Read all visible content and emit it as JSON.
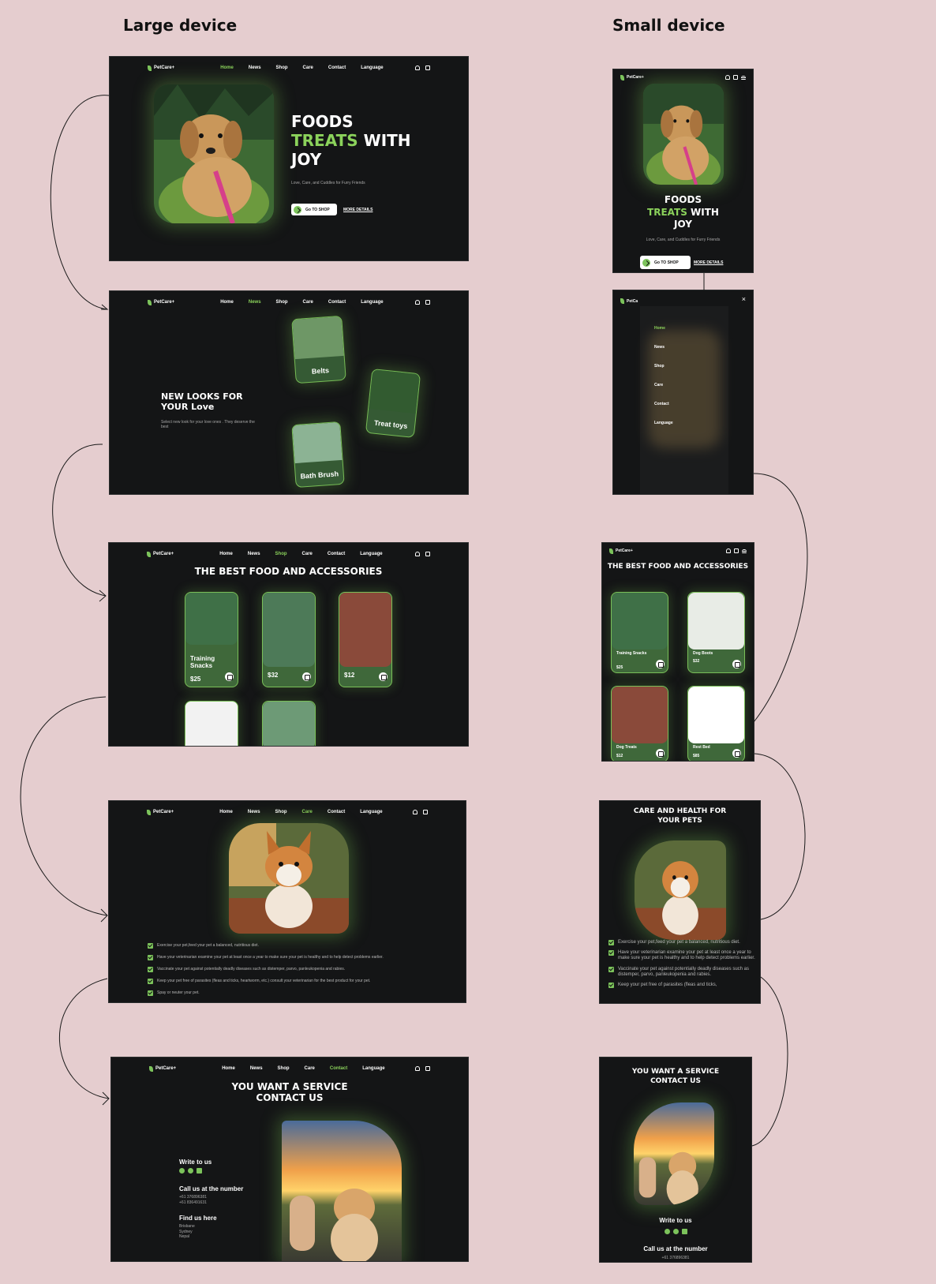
{
  "headings": {
    "large": "Large device",
    "small": "Small device"
  },
  "brand": "PetCare+",
  "nav_items": [
    "Home",
    "News",
    "Shop",
    "Care",
    "Contact",
    "Language"
  ],
  "hero": {
    "line1": "FOODS",
    "line2_green": "TREATS",
    "line2_rest": " WITH",
    "line3": "JOY",
    "subtitle": "Love, Care, and Cuddles for Furry Friends",
    "cta": "Go TO SHOP",
    "more": "MORE DETAILS"
  },
  "news": {
    "title": "NEW LOOKS FOR YOUR Love",
    "subtitle": "Select new look for your love ones . They deserve the best",
    "categories": [
      "Belts",
      "Treat toys",
      "Bath Brush"
    ]
  },
  "shop": {
    "title": "THE BEST FOOD AND ACCESSORIES",
    "products": [
      {
        "name": "Training Snacks",
        "price": "$25"
      },
      {
        "name": "",
        "price": "$32"
      },
      {
        "name": "",
        "price": "$12"
      }
    ],
    "mobile_products": [
      {
        "name": "Training Snacks",
        "price": "$25"
      },
      {
        "name": "Dog Boots",
        "price": "$32"
      },
      {
        "name": "Dog Treats",
        "price": "$12"
      },
      {
        "name": "Rest Bed",
        "price": "$85"
      }
    ]
  },
  "care": {
    "title": "CARE AND HEALTH FOR YOUR PETS",
    "items": [
      "Exercise your pet,feed your pet a balanced, nutritious diet.",
      "Have your veterinarian examine your pet at least once a year to make sure your pet is healthy and to help detect problems earlier.",
      "Vaccinate your pet against potentially deadly diseases such as distemper, parvo, panleukopenia and rabies.",
      "Keep your pet free of parasites (fleas and ticks, heartworm, etc.) consult your veterinarian for the best product for your pet.",
      "Spay or neuter your pet."
    ],
    "mobile_items": [
      "Exercise your pet,feed your pet a balanced, nutritious diet.",
      "Have your veterinarian examine your pet at least once a year to make sure your pet is healthy and to help detect problems earlier.",
      "Vaccinate your pet against potentially deadly diseases such as distemper, parvo, panleukopenia and rabies.",
      "Keep your pet free of parasites (fleas and ticks,"
    ]
  },
  "contact": {
    "title_line1": "YOU WANT A SERVICE",
    "title_line2": "CONTACT US",
    "write": "Write to us",
    "call": "Call us at the number",
    "phones": [
      "+61 376896381",
      "+61 836491631"
    ],
    "find": "Find us here",
    "places": [
      "Brisbane",
      "Sydney",
      "Nepal"
    ],
    "mobile_phone": "+61 376896381"
  },
  "mobile_menu": {
    "close": "×",
    "brand_cut": "PetCa"
  },
  "colors": {
    "page_bg": "#e5cdcf",
    "frame_bg": "#141516",
    "accent": "#8bd25b",
    "card_green": "#3f683a"
  },
  "icons": [
    "user-icon",
    "cart-icon",
    "menu-icon",
    "close-icon",
    "arrow-icon",
    "bag-icon",
    "check-icon",
    "whatsapp-icon",
    "messenger-icon",
    "mail-icon",
    "leaf-icon"
  ]
}
